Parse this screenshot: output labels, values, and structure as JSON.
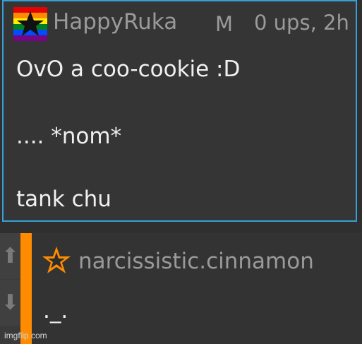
{
  "comment_top": {
    "username": "HappyRuka",
    "flair": "M",
    "meta": "0 ups, 2h",
    "lines": [
      "OvO a coo-cookie :D",
      ".... *nom*",
      "tank chu"
    ],
    "avatar_icon": "rainbow-star-flag-icon",
    "accent_color": "#36a0d6"
  },
  "comment_bottom": {
    "username": "narcissistic.cinnamon",
    "text": "._.",
    "avatar_icon": "orange-star-icon",
    "accent_color": "#ff8c00",
    "upvote_icon": "upvote-arrow-icon",
    "downvote_icon": "downvote-arrow-icon"
  },
  "watermark": "imgflip.com"
}
